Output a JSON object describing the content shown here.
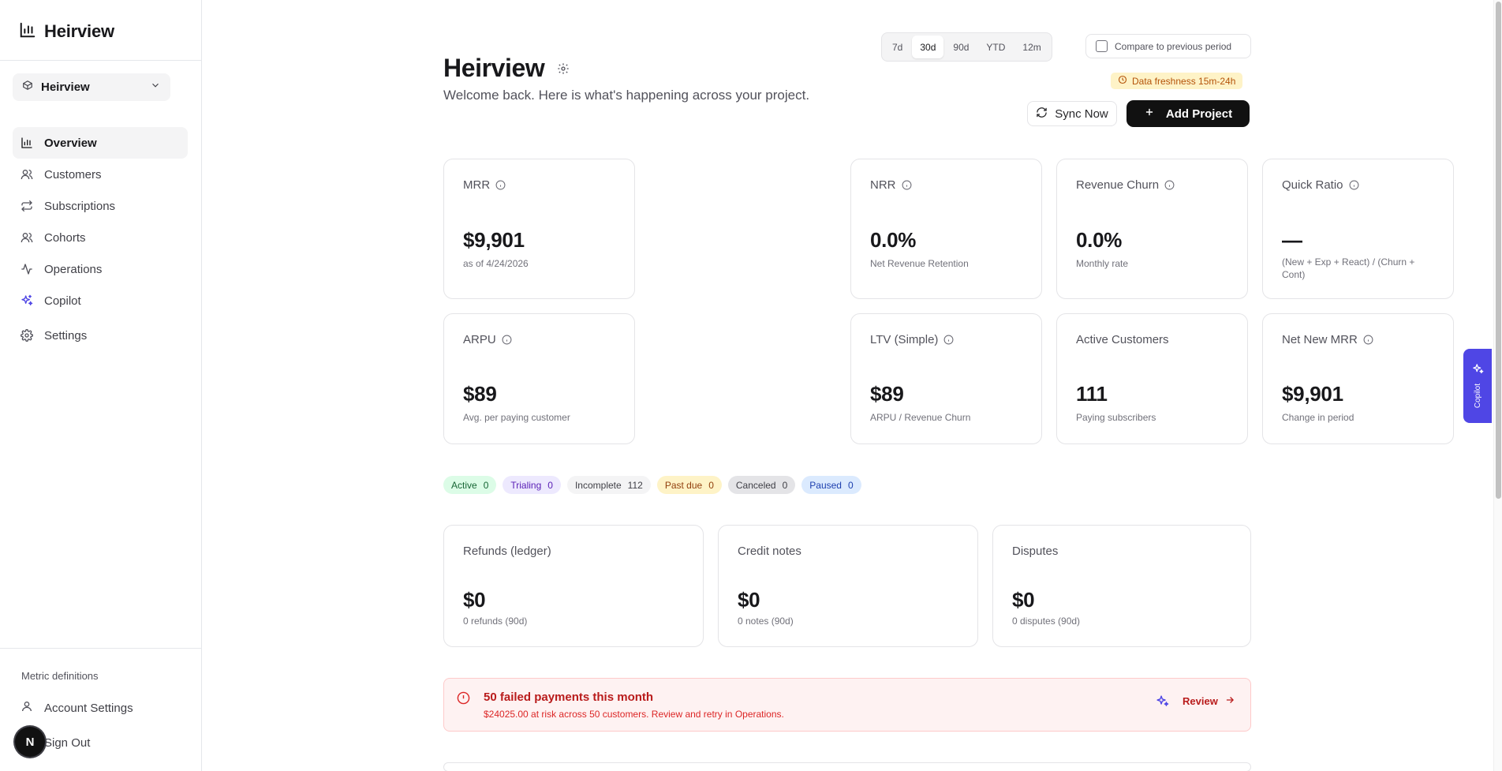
{
  "sidebar": {
    "brand": "Heirview",
    "project_selector": "Heirview",
    "nav": [
      {
        "label": "Overview",
        "icon": "bar-chart-icon"
      },
      {
        "label": "Customers",
        "icon": "users-icon"
      },
      {
        "label": "Subscriptions",
        "icon": "repeat-icon"
      },
      {
        "label": "Cohorts",
        "icon": "users-icon"
      },
      {
        "label": "Operations",
        "icon": "activity-icon"
      },
      {
        "label": "Copilot",
        "icon": "sparkles-icon"
      },
      {
        "label": "Settings",
        "icon": "gear-icon"
      }
    ],
    "metric_definitions": "Metric definitions",
    "account_settings": "Account Settings",
    "sign_out": "Sign Out",
    "avatar_initial": "N"
  },
  "header": {
    "title": "Heirview",
    "subtitle": "Welcome back. Here is what's happening across your project.",
    "periods": [
      "7d",
      "30d",
      "90d",
      "YTD",
      "12m"
    ],
    "active_period": "30d",
    "compare_label": "Compare to previous period",
    "compare_checked": false,
    "freshness": "Data freshness 15m-24h",
    "sync_label": "Sync Now",
    "add_label": "Add Project"
  },
  "kpis": [
    {
      "label": "MRR",
      "value": "$9,901",
      "sub": "as of 4/24/2026",
      "info": true
    },
    {
      "label": "NRR",
      "value": "0.0%",
      "sub": "Net Revenue Retention",
      "info": true
    },
    {
      "label": "Revenue Churn",
      "value": "0.0%",
      "sub": "Monthly rate",
      "info": true
    },
    {
      "label": "Quick Ratio",
      "value": "—",
      "sub": "(New + Exp + React) / (Churn + Cont)",
      "info": true
    },
    {
      "label": "ARPU",
      "value": "$89",
      "sub": "Avg. per paying customer",
      "info": true
    },
    {
      "label": "LTV (Simple)",
      "value": "$89",
      "sub": "ARPU / Revenue Churn",
      "info": true
    },
    {
      "label": "Active Customers",
      "value": "111",
      "sub": "Paying subscribers",
      "info": false
    },
    {
      "label": "Net New MRR",
      "value": "$9,901",
      "sub": "Change in period",
      "info": true
    }
  ],
  "status_badges": [
    {
      "label": "Active",
      "count": "0",
      "bg": "#dcfce7",
      "fg": "#166534"
    },
    {
      "label": "Trialing",
      "count": "0",
      "bg": "#ede9fe",
      "fg": "#5b21b6"
    },
    {
      "label": "Incomplete",
      "count": "112",
      "bg": "#f4f4f5",
      "fg": "#3f3f46"
    },
    {
      "label": "Past due",
      "count": "0",
      "bg": "#fef3c7",
      "fg": "#92400e"
    },
    {
      "label": "Canceled",
      "count": "0",
      "bg": "#e4e4e7",
      "fg": "#3f3f46"
    },
    {
      "label": "Paused",
      "count": "0",
      "bg": "#dbeafe",
      "fg": "#1e40af"
    }
  ],
  "ledger_cards": [
    {
      "label": "Refunds (ledger)",
      "value": "$0",
      "sub": "0 refunds (90d)"
    },
    {
      "label": "Credit notes",
      "value": "$0",
      "sub": "0 notes (90d)"
    },
    {
      "label": "Disputes",
      "value": "$0",
      "sub": "0 disputes (90d)"
    }
  ],
  "alert": {
    "title": "50 failed payments this month",
    "message": "$24025.00 at risk across 50 customers. Review and retry in Operations.",
    "action": "Review"
  },
  "copilot_tab": "Copilot",
  "colors": {
    "accent": "#4f46e5",
    "danger": "#b91c1c",
    "warning": "#b45309"
  }
}
